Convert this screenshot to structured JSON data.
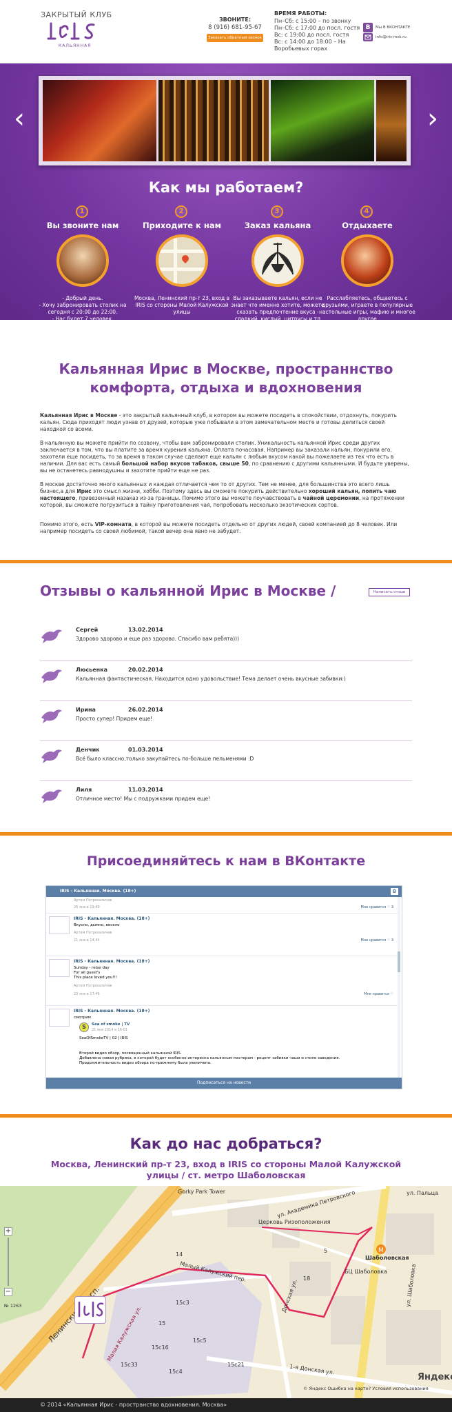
{
  "header": {
    "club_label": "ЗАКРЫТЫЙ КЛУБ",
    "logo_text": "Iris",
    "logo_sub": "КАЛЬЯННАЯ",
    "call_label": "ЗВОНИТЕ:",
    "phone": "8 (916) 681-95-67",
    "callback_button": "Заказать обратный звонок",
    "hours_title": "ВРЕМЯ РАБОТЫ:",
    "hours": [
      "Пн–Сб: с 15:00 – по звонку",
      "Пн–Сб: с 17:00 до посл. гостя",
      "Вс: с 19:00 до посл. гостя",
      "Вс: с 14:00 до 18:00 – На Воробьевых горах"
    ],
    "vk_icon_letter": "В",
    "vk_text": "Мы В ВКОНТАКТЕ",
    "email": "info@iris-msk.ru"
  },
  "slider": {
    "prev": "‹",
    "next": "›"
  },
  "how": {
    "title": "Как мы работаем?",
    "steps": [
      {
        "num": "1",
        "title": "Вы звоните нам",
        "text": "- Добрый день.\n- Хочу забронировать столик на сегодня с 20:00 до 22:00.\n- Нас будет 7 человек."
      },
      {
        "num": "2",
        "title": "Приходите к нам",
        "text": "Москва, Ленинский пр-т 23, вход в IRIS со стороны Малой Калужской улицы"
      },
      {
        "num": "3",
        "title": "Заказ кальяна",
        "text": "Вы заказываете кальян, если не знает что именно хотите, можете сказать предпочтение вкуса - сладкий, кислый, цитрусы и тд"
      },
      {
        "num": "4",
        "title": "Отдыхаете",
        "text": "Расслабляетесь, общаетесь с друзьями, играете в популярные настольные игры, мафию и многое другое"
      }
    ]
  },
  "about": {
    "title": "Кальянная Ирис в Москве, пространнство комфорта, отдыха и вдохновения",
    "p1_bold": "Кальянная Ирис в Москве",
    "p1": " - это закрытый кальянный клуб, в котором вы можете посидеть в спокойствии, отдохнуть, покурить кальян. Сюда приходят люди узнав от друзей, которые уже побывали в этом замечательном месте и готовы делиться своей находкой со всеми.",
    "p2_a": "В кальянную вы можете прийти по созвону, чтобы вам забронировали столик. Уникальность кальянной Ирис среди других заключается в том, что вы платите за время курения кальяна. Оплата почасовая. Например вы заказали кальян, покурили его, захотели еще посидеть, то за время в таком случае сделают еще кальян с любым вкусом какой вы пожелаете из тех что есть в наличии. Для вас есть самый ",
    "p2_bold": "большой набор вкусов табаков, свыше 50",
    "p2_b": ", по сравнению с другими кальянными. И будьте уверены, вы не останетесь равнодушны и захотите прийти еще не раз.",
    "p3_a": "В москве достаточно много кальянных и каждая отличается чем то от других. Тем не менее, для большинства это всего лишь бизнес,а для ",
    "p3_bold1": "Ирис",
    "p3_b": " это смысл жизни, хобби. Поэтому здесь вы сможете покурить действительно ",
    "p3_bold2": "хороший кальян, попить чаю настоящего",
    "p3_c": ", привезенный назаказ из-за границы. Помимо этого вы можете поучавствовать в ",
    "p3_bold3": "чайной церемонии",
    "p3_d": ", на протяжении которой, вы сможете погрузиться в тайну приготовления чая, попробовать несколько экзотических сортов.",
    "p4_a": "Помимо этого, есть ",
    "p4_bold": "VIP-комната",
    "p4_b": ", в которой вы можете посидеть отдельно от других людей, своей компанией до 8 человек. Или например посидеть со своей любимой, такой вечер она явно не забудет."
  },
  "reviews": {
    "title": "Отзывы о кальянной Ирис в Москве /",
    "write_button": "Написать отзыв",
    "items": [
      {
        "name": "Сергей",
        "date": "13.02.2014",
        "text": "Здорово здорово и еще раз здорово. Спасибо вам ребята)))"
      },
      {
        "name": "Люсьенка",
        "date": "20.02.2014",
        "text": "Кальянная фантастическая. Находится одно удовольствие! Тема делает очень вкусные забивки:)"
      },
      {
        "name": "Ирина",
        "date": "26.02.2014",
        "text": "Просто супер! Придем еще!"
      },
      {
        "name": "Денчик",
        "date": "01.03.2014",
        "text": "Всё было классно,только закупайтесь по-больше пельменями :D"
      },
      {
        "name": "Лиля",
        "date": "11.03.2014",
        "text": "Отличное место! Мы с подружками придем еще!"
      }
    ]
  },
  "vk": {
    "title": "Присоединяйтесь к нам в ВКонтакте",
    "header": "IRIS - Кальянная. Москва. (18+)",
    "b_letter": "В",
    "posts": [
      {
        "name": "IRIS - Кальянная. Москва. (18+)",
        "text": "Вкусно, дымно, весело",
        "author": "Артем Потрехаличев",
        "meta": "21 янв в 14:44",
        "like": "Мне нравится ♡ 3"
      },
      {
        "name": "IRIS - Кальянная. Москва. (18+)",
        "text": "Sunday - relax day\nFor all guest's\nThis place loved you!!!",
        "author": "Артем Потрехаличев",
        "meta": "23 янв в 17:46",
        "like": "Мне нравится ♡"
      },
      {
        "name": "IRIS - Кальянная. Москва. (18+)",
        "text": "смотрим",
        "repost": "Sea of smoke | TV",
        "repost_date": "21 янв 2014 в 16:01",
        "repost_sub": "SeaOfSmokeTV | 02 | IRIS",
        "body": "Второй видео обзор, посвященный кальянной IRIS.\nДобавлена новая рубрика, в которой будет особенно интересна кальянным мастерам - рецепт забивки чаши и стиле заведения.\nПродолжительность видео обзора по-прежнему была увеличена."
      }
    ],
    "top_author": "Артем Потрехаличев",
    "top_meta": "26 янв в 19:49",
    "top_like": "Мне нравится ♡ 3",
    "join": "Подписаться на новости"
  },
  "directions": {
    "title": "Как до нас добраться?",
    "address": "Москва, Ленинский пр-т 23, вход в IRIS со стороны Малой Калужской улицы / ст. метро Шаболовская"
  },
  "map": {
    "labels": [
      "Gorky Park Tower",
      "ул. Академика Петровского",
      "Церковь Ризоположения",
      "Ленинский просп.",
      "Малый Калужский пер.",
      "Малая Калужская ул.",
      "Донская ул.",
      "Шаболовская",
      "ул. Шаболовка",
      "ул. Лусовая",
      "1-я Донская ул.",
      "БЦ Шаболовка",
      "ул. Пальца"
    ],
    "building_numbers": [
      "15",
      "15с3",
      "15с16",
      "15с5",
      "15с4",
      "14",
      "15с33",
      "15с21",
      "18",
      "5",
      "12",
      "7",
      "8",
      "18с2",
      "16"
    ],
    "zoom_plus": "+",
    "zoom_minus": "−",
    "scale": "№ 1263",
    "yandex": "Яндекс",
    "copyright": "© Яндекс   Ошибка на карте?  Условия использования"
  },
  "footer": {
    "text": "© 2014 «Кальянная Ирис - пространство вдохновения. Москва»"
  },
  "colors": {
    "purple": "#7b3f9c",
    "orange": "#ef8c1d",
    "vk_blue": "#5b7fa6"
  }
}
